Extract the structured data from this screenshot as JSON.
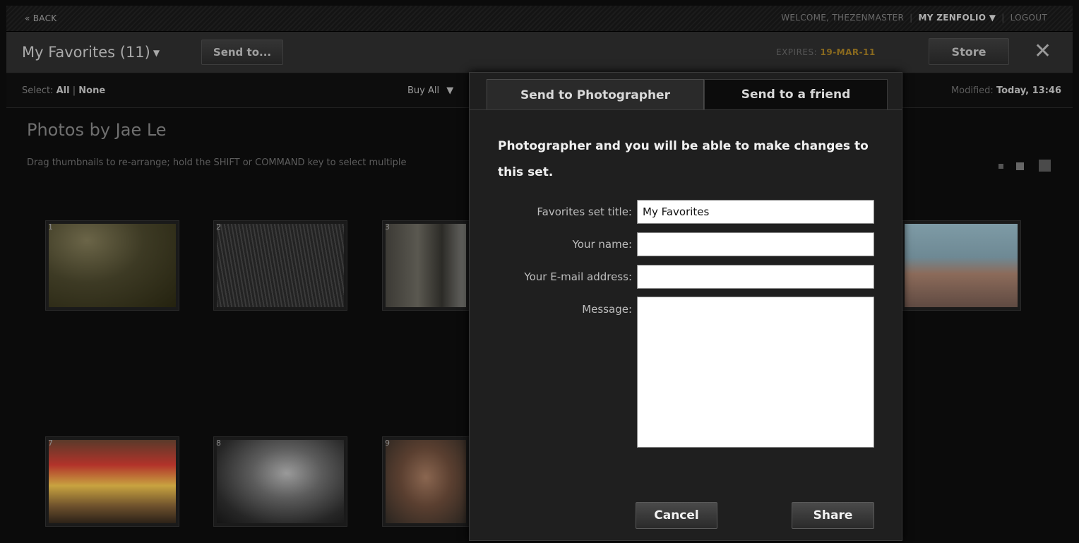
{
  "topbar": {
    "back_label": "« BACK",
    "welcome": "WELCOME, THEZENMASTER",
    "my_zenfolio": "MY ZENFOLIO",
    "logout": "LOGOUT"
  },
  "header": {
    "favorites_title": "My Favorites (11)",
    "send_to_button": "Send to...",
    "expires_label": "EXPIRES:",
    "expires_date": "19-MAR-11",
    "store_button": "Store"
  },
  "selectrow": {
    "select_label": "Select:",
    "all": "All",
    "separator": "|",
    "none": "None",
    "buy_all": "Buy All",
    "modified_label": "Modified:",
    "modified_value": "Today, 13:46"
  },
  "content": {
    "photos_title": "Photos by Jae Le",
    "hint": "Drag thumbnails to re-arrange; hold the SHIFT or COMMAND key to select multiple"
  },
  "thumbnails": [
    {
      "num": "1",
      "style": "sepia-field"
    },
    {
      "num": "2",
      "style": "bw-grass"
    },
    {
      "num": "3",
      "style": "street-buildings"
    },
    {
      "num": "",
      "style": "beach-couple"
    },
    {
      "num": "7",
      "style": "yellow-train"
    },
    {
      "num": "8",
      "style": "bw-portrait"
    },
    {
      "num": "9",
      "style": "couple-closeup"
    }
  ],
  "modal": {
    "tab_photographer": "Send to Photographer",
    "tab_friend": "Send to a friend",
    "description": "Photographer and you will be able to make changes to this set.",
    "favorites_set_title_label": "Favorites set title:",
    "favorites_set_title_value": "My Favorites",
    "your_name_label": "Your name:",
    "your_name_value": "",
    "email_label": "Your E-mail address:",
    "email_value": "",
    "message_label": "Message:",
    "message_value": "",
    "cancel_button": "Cancel",
    "share_button": "Share"
  }
}
